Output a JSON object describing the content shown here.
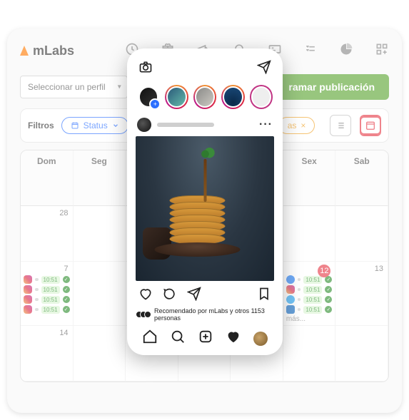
{
  "brand": {
    "name": "mLabs"
  },
  "toolbar": {
    "select_profile": "Seleccionar un perfil",
    "schedule_btn": "ramar publicación"
  },
  "filters": {
    "label": "Filtros",
    "status": "Status",
    "tags": "as",
    "remove": "×"
  },
  "calendar": {
    "days": [
      "Dom",
      "Seg",
      "",
      "",
      "",
      "Sex",
      "Sab"
    ],
    "week1": [
      "28",
      "",
      "",
      "",
      "",
      "",
      ""
    ],
    "week2": [
      "7",
      "",
      "",
      "",
      "",
      "12",
      "13"
    ],
    "week3": [
      "14",
      "",
      "",
      "",
      "",
      "",
      ""
    ],
    "time": "10:51",
    "more": "más..."
  },
  "instagram": {
    "likes_text": "Recomendado por mLabs y otros 1153 personas"
  }
}
